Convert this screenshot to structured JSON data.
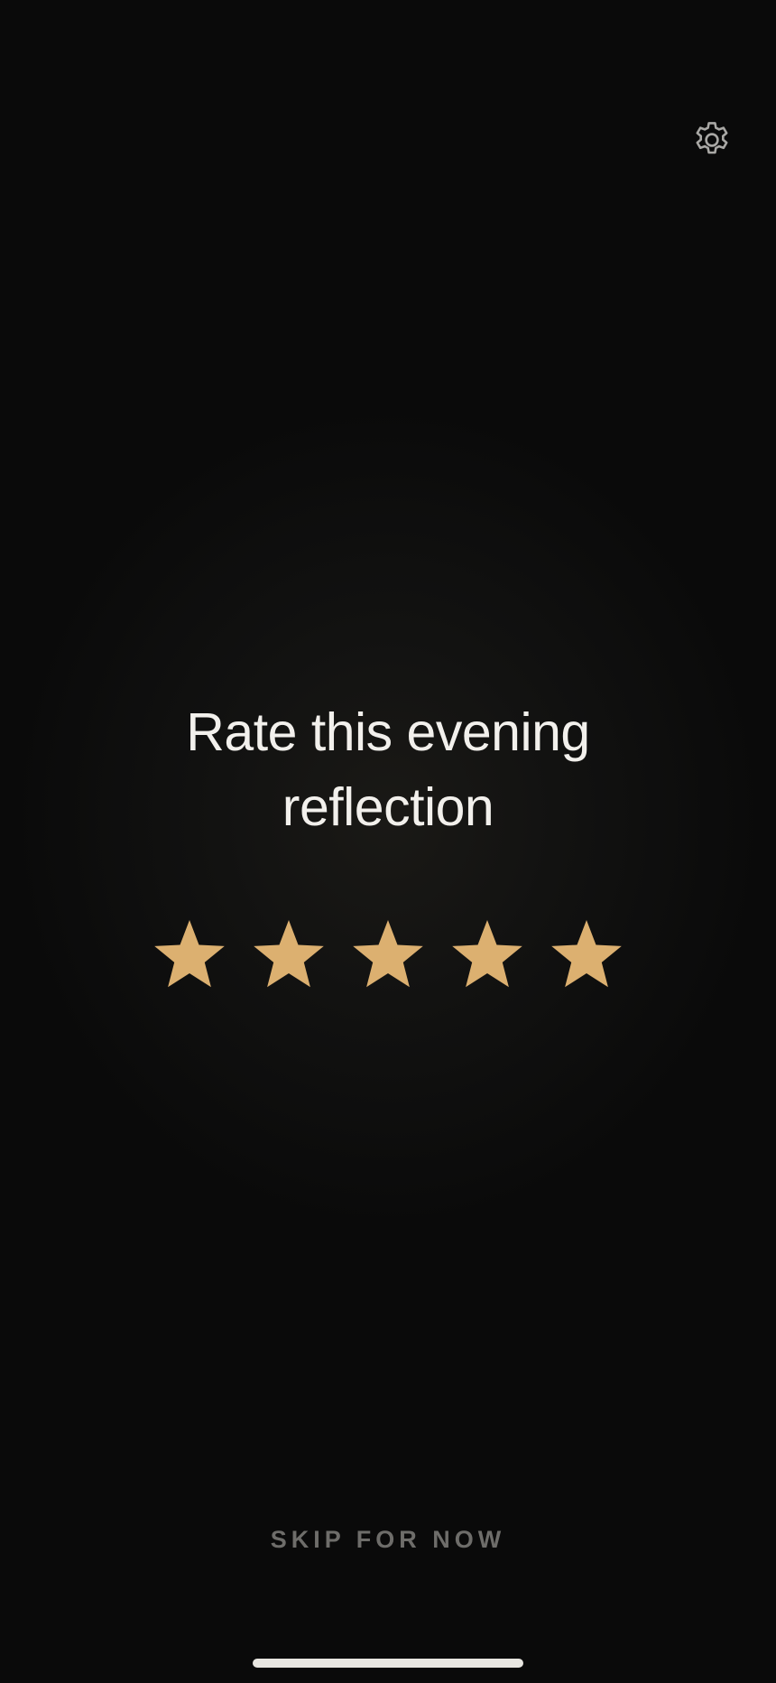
{
  "header": {
    "settings_icon": "gear-icon"
  },
  "rating": {
    "title_line1": "Rate this evening",
    "title_line2": "reflection",
    "star_icon": "star-icon",
    "max_stars": 5,
    "selected_stars": 5,
    "star_color": "#dcb070"
  },
  "footer": {
    "skip_label": "SKIP FOR NOW"
  },
  "colors": {
    "background": "#0a0a0a",
    "title": "#f2f0ec",
    "skip": "#6e6d6a",
    "home_indicator": "#e8e6e1"
  }
}
